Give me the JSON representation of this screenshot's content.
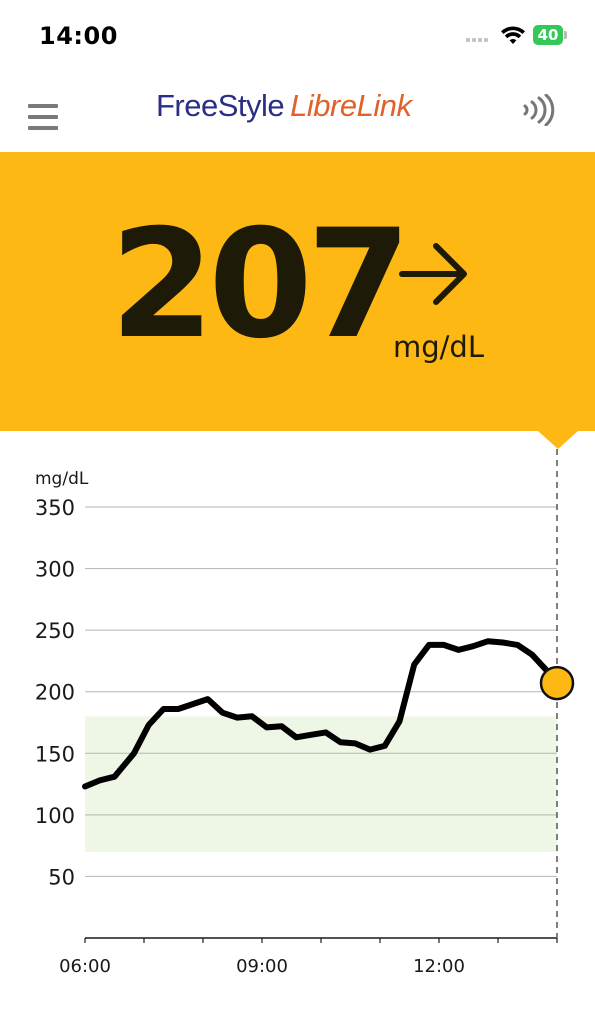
{
  "status_bar": {
    "time": "14:00",
    "battery": "40"
  },
  "header": {
    "logo_part1": "FreeStyle",
    "logo_part2": "LibreLink",
    "menu_icon": "hamburger-menu-icon",
    "scan_icon": "nfc-scan-icon"
  },
  "reading": {
    "value": "207",
    "unit": "mg/dL",
    "trend": "steady",
    "trend_icon": "arrow-right-icon"
  },
  "colors": {
    "banner": "#fdb814",
    "target_range": "#eef7e6",
    "logo_primary": "#2b2e86",
    "logo_accent": "#e0622b"
  },
  "chart_data": {
    "type": "line",
    "ylabel": "mg/dL",
    "ylim": [
      0,
      350
    ],
    "yticks": [
      350,
      300,
      250,
      200,
      150,
      100,
      50
    ],
    "xticks": [
      "06:00",
      "09:00",
      "12:00"
    ],
    "xlim": [
      6.0,
      14.0
    ],
    "target_range": [
      70,
      180
    ],
    "current": {
      "time": 14.0,
      "value": 207
    },
    "series": [
      {
        "x": [
          6.0,
          6.25,
          6.5,
          6.83,
          7.08,
          7.33,
          7.58,
          8.08,
          8.33,
          8.58,
          8.83,
          9.08,
          9.33,
          9.58,
          9.83,
          10.08,
          10.33,
          10.58,
          10.83,
          11.08,
          11.33,
          11.58,
          11.83,
          12.08,
          12.33,
          12.58,
          12.83,
          13.08,
          13.33,
          13.58,
          13.83,
          14.0
        ],
        "y": [
          123,
          128,
          131,
          150,
          173,
          186,
          186,
          194,
          183,
          179,
          180,
          171,
          172,
          163,
          165,
          167,
          159,
          158,
          153,
          156,
          176,
          222,
          238,
          238,
          234,
          237,
          241,
          240,
          238,
          230,
          217,
          207
        ]
      }
    ]
  }
}
